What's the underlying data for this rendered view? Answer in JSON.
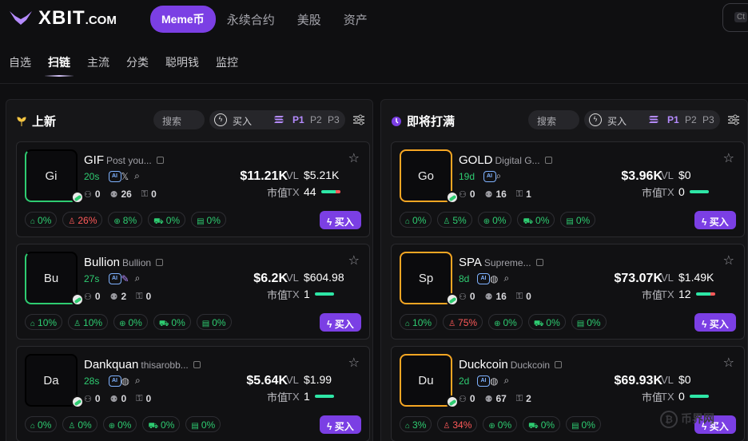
{
  "logo": {
    "text": "XBIT",
    "suffix": ".COM"
  },
  "nav": {
    "active": "Meme币",
    "tabs": [
      "永续合约",
      "美股",
      "资产"
    ]
  },
  "search": {
    "shortcut": "Ct"
  },
  "subtabs": [
    "自选",
    "扫链",
    "主流",
    "分类",
    "聪明钱",
    "监控"
  ],
  "panels": [
    {
      "title": "上新",
      "search_label": "搜索",
      "buy_label": "买入",
      "pages": [
        "P1",
        "P2",
        "P3"
      ],
      "cards": [
        {
          "avatar": "Gi",
          "name": "GIF",
          "sub": "Post you...",
          "age": "20s",
          "holders": "0",
          "users": "26",
          "locks": "0",
          "mcap": "$11.21K",
          "mcap_label": "市值",
          "vl": "$5.21K",
          "tx": "44",
          "tx_bar": "mix",
          "chips": [
            "0%",
            "26%",
            "8%",
            "0%",
            "0%"
          ],
          "chip_red": [
            false,
            true,
            false,
            false,
            false
          ],
          "buy": "买入",
          "border": "gif",
          "socials": [
            "ai",
            "x",
            "search"
          ]
        },
        {
          "avatar": "Bu",
          "name": "Bullion",
          "sub": "Bullion",
          "age": "27s",
          "holders": "0",
          "users": "2",
          "locks": "0",
          "mcap": "$6.2K",
          "mcap_label": "市值",
          "vl": "$604.98",
          "tx": "1",
          "tx_bar": "green",
          "chips": [
            "10%",
            "10%",
            "0%",
            "0%",
            "0%"
          ],
          "chip_red": [
            false,
            false,
            false,
            false,
            false
          ],
          "buy": "买入",
          "border": "gif",
          "socials": [
            "ai",
            "feather",
            "search"
          ]
        },
        {
          "avatar": "Da",
          "name": "Dankquan",
          "sub": "thisarobb...",
          "age": "28s",
          "holders": "0",
          "users": "0",
          "locks": "0",
          "mcap": "$5.64K",
          "mcap_label": "市值",
          "vl": "$1.99",
          "tx": "1",
          "tx_bar": "green",
          "chips": [
            "0%",
            "0%",
            "0%",
            "0%",
            "0%"
          ],
          "chip_red": [
            false,
            false,
            false,
            false,
            false
          ],
          "buy": "买入",
          "border": "dark",
          "socials": [
            "ai",
            "globe",
            "search"
          ]
        }
      ]
    },
    {
      "title": "即将打满",
      "search_label": "搜索",
      "buy_label": "买入",
      "pages": [
        "P1",
        "P2",
        "P3"
      ],
      "cards": [
        {
          "avatar": "Go",
          "name": "GOLD",
          "sub": "Digital G...",
          "age": "19d",
          "holders": "0",
          "users": "16",
          "locks": "1",
          "mcap": "$3.96K",
          "mcap_label": "市值",
          "vl": "$0",
          "tx": "0",
          "tx_bar": "green",
          "chips": [
            "0%",
            "5%",
            "0%",
            "0%",
            "0%"
          ],
          "chip_red": [
            false,
            false,
            false,
            false,
            false
          ],
          "buy": "买入",
          "border": "gold",
          "socials": [
            "ai",
            "search"
          ]
        },
        {
          "avatar": "Sp",
          "name": "SPA",
          "sub": "Supreme...",
          "age": "8d",
          "holders": "0",
          "users": "16",
          "locks": "0",
          "mcap": "$73.07K",
          "mcap_label": "市值",
          "vl": "$1.49K",
          "tx": "12",
          "tx_bar": "red",
          "chips": [
            "10%",
            "75%",
            "0%",
            "0%",
            "0%"
          ],
          "chip_red": [
            false,
            true,
            false,
            false,
            false
          ],
          "buy": "买入",
          "border": "gold",
          "socials": [
            "ai",
            "globe",
            "search"
          ]
        },
        {
          "avatar": "Du",
          "name": "Duckcoin",
          "sub": "Duckcoin",
          "age": "2d",
          "holders": "0",
          "users": "67",
          "locks": "2",
          "mcap": "$69.93K",
          "mcap_label": "市值",
          "vl": "$0",
          "tx": "0",
          "tx_bar": "green",
          "chips": [
            "3%",
            "34%",
            "0%",
            "0%",
            "0%"
          ],
          "chip_red": [
            false,
            true,
            false,
            false,
            false
          ],
          "buy": "买入",
          "border": "gold",
          "socials": [
            "ai",
            "globe",
            "search"
          ]
        }
      ]
    }
  ],
  "watermark": "币界网",
  "colors": {
    "accent": "#7b3fe4",
    "green": "#2ecc71",
    "red": "#ff5a5a",
    "gold": "#f5a623"
  }
}
